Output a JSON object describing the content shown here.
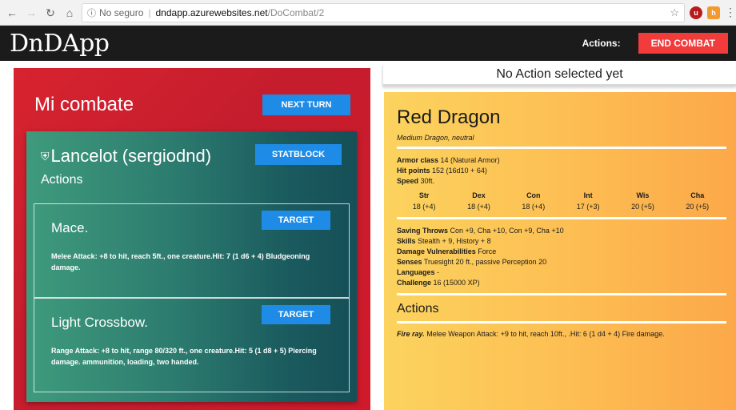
{
  "browser": {
    "info_icon": "info-icon",
    "insecure_label": "No seguro",
    "host": "dndapp.azurewebsites.net",
    "path": "/DoCombat/2"
  },
  "header": {
    "logo": "DnDApp",
    "actions_label": "Actions:",
    "end_combat_label": "END COMBAT"
  },
  "combat": {
    "title": "Mi combate",
    "next_turn_label": "NEXT TURN",
    "character": {
      "name": "Lancelot (sergiodnd)",
      "statblock_label": "STATBLOCK",
      "actions_heading": "Actions",
      "actions": [
        {
          "name": "Mace.",
          "target_label": "TARGET",
          "description": "Melee Attack: +8 to hit, reach 5ft., one creature.Hit: 7 (1 d6 + 4) Bludgeoning damage."
        },
        {
          "name": "Light Crossbow.",
          "target_label": "TARGET",
          "description": "Range Attack: +8 to hit, range 80/320 ft., one creature.Hit: 5 (1 d8 + 5) Piercing damage. ammunition, loading, two handed."
        }
      ]
    }
  },
  "status": {
    "text": "No Action selected yet"
  },
  "monster": {
    "name": "Red Dragon",
    "type": "Medium Dragon, neutral",
    "armor_label": "Armor class",
    "armor_value": "14 (Natural Armor)",
    "hp_label": "Hit points",
    "hp_value": "152 (16d10 + 64)",
    "speed_label": "Speed",
    "speed_value": "30ft.",
    "stats": [
      {
        "label": "Str",
        "value": "18 (+4)"
      },
      {
        "label": "Dex",
        "value": "18 (+4)"
      },
      {
        "label": "Con",
        "value": "18 (+4)"
      },
      {
        "label": "Int",
        "value": "17 (+3)"
      },
      {
        "label": "Wis",
        "value": "20 (+5)"
      },
      {
        "label": "Cha",
        "value": "20 (+5)"
      }
    ],
    "saving_label": "Saving Throws",
    "saving_value": "Con +9, Cha +10, Con +9, Cha +10",
    "skills_label": "Skills",
    "skills_value": "Stealth + 9, History + 8",
    "vuln_label": "Damage Vulnerabilities",
    "vuln_value": "Force",
    "senses_label": "Senses",
    "senses_value": "Truesight 20 ft., passive Perception 20",
    "languages_label": "Languages",
    "languages_value": "-",
    "challenge_label": "Challenge",
    "challenge_value": "16 (15000 XP)",
    "actions_heading": "Actions",
    "action_name": "Fire ray.",
    "action_desc": "Melee Weapon Attack: +9 to hit, reach 10ft., .Hit: 6 (1 d4 + 4) Fire damage."
  },
  "colors": {
    "end_combat": "#f23b3b",
    "button_blue": "#1e8ce6",
    "combat_red": "#d01a2b",
    "monster_yellow": "#fdbd52"
  }
}
